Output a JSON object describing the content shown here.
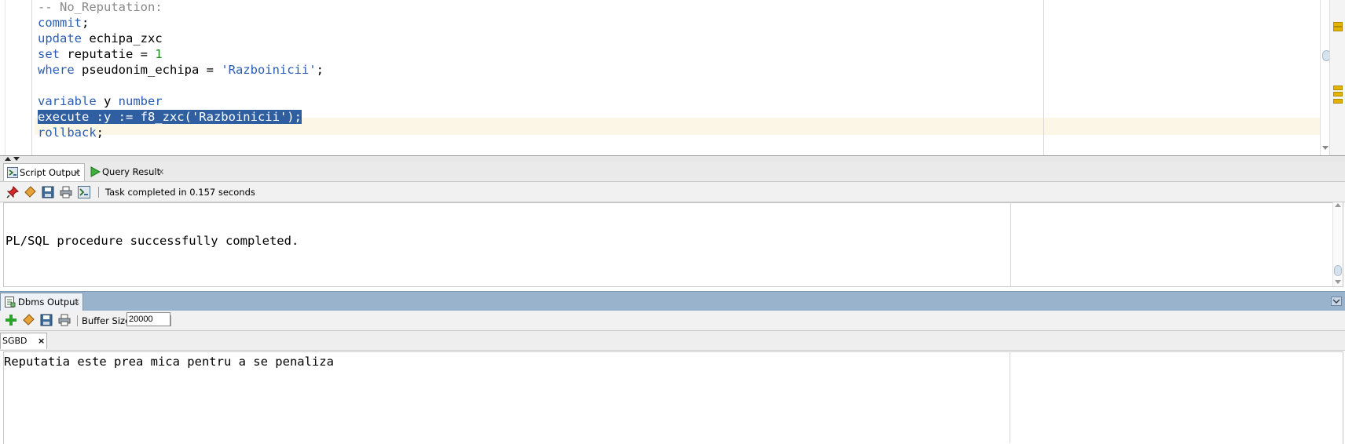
{
  "editor": {
    "lines": [
      {
        "segments": [
          {
            "t": "-- No_Reputation:",
            "c": "cmt"
          }
        ]
      },
      {
        "segments": [
          {
            "t": "commit",
            "c": "kw"
          },
          {
            "t": ";",
            "c": ""
          }
        ]
      },
      {
        "segments": [
          {
            "t": "update",
            "c": "kw"
          },
          {
            "t": " echipa_zxc",
            "c": ""
          }
        ]
      },
      {
        "segments": [
          {
            "t": "set",
            "c": "kw"
          },
          {
            "t": " reputatie = ",
            "c": ""
          },
          {
            "t": "1",
            "c": "num"
          }
        ]
      },
      {
        "segments": [
          {
            "t": "where",
            "c": "kw"
          },
          {
            "t": " pseudonim_echipa = ",
            "c": ""
          },
          {
            "t": "'Razboinicii'",
            "c": "str"
          },
          {
            "t": ";",
            "c": ""
          }
        ]
      },
      {
        "segments": []
      },
      {
        "segments": [
          {
            "t": "variable",
            "c": "kw"
          },
          {
            "t": " y ",
            "c": ""
          },
          {
            "t": "number",
            "c": "kw"
          }
        ]
      },
      {
        "segments": [
          {
            "t": "execute :y := f8_zxc('Razboinicii');",
            "c": "sel"
          }
        ]
      },
      {
        "segments": [
          {
            "t": "rollback",
            "c": "kw"
          },
          {
            "t": ";",
            "c": ""
          }
        ]
      }
    ]
  },
  "script_panel": {
    "tabs": [
      {
        "label": "Script Output",
        "close": "x",
        "icon": "script-output-icon"
      },
      {
        "label": "Query Result",
        "close": "x",
        "icon": "play-icon"
      }
    ],
    "toolbar_icons": [
      "pin-icon",
      "eraser-icon",
      "save-icon",
      "print-icon",
      "script-icon"
    ],
    "status": "Task completed in 0.157 seconds",
    "output": "PL/SQL procedure successfully completed."
  },
  "dbms_panel": {
    "title": "Dbms Output",
    "close": "×",
    "toolbar_icons": [
      "add-icon",
      "eraser-icon",
      "save-icon",
      "print-icon"
    ],
    "buffer_label": "Buffer Size:",
    "buffer_value": "20000",
    "connection_tab": "SGBD",
    "connection_close": "×",
    "output": "Reputatia este prea mica pentru a se penaliza"
  },
  "colors": {
    "keyword": "#2a5db0",
    "selection": "#2f5fa0",
    "panel_header": "#9ab3cc"
  }
}
